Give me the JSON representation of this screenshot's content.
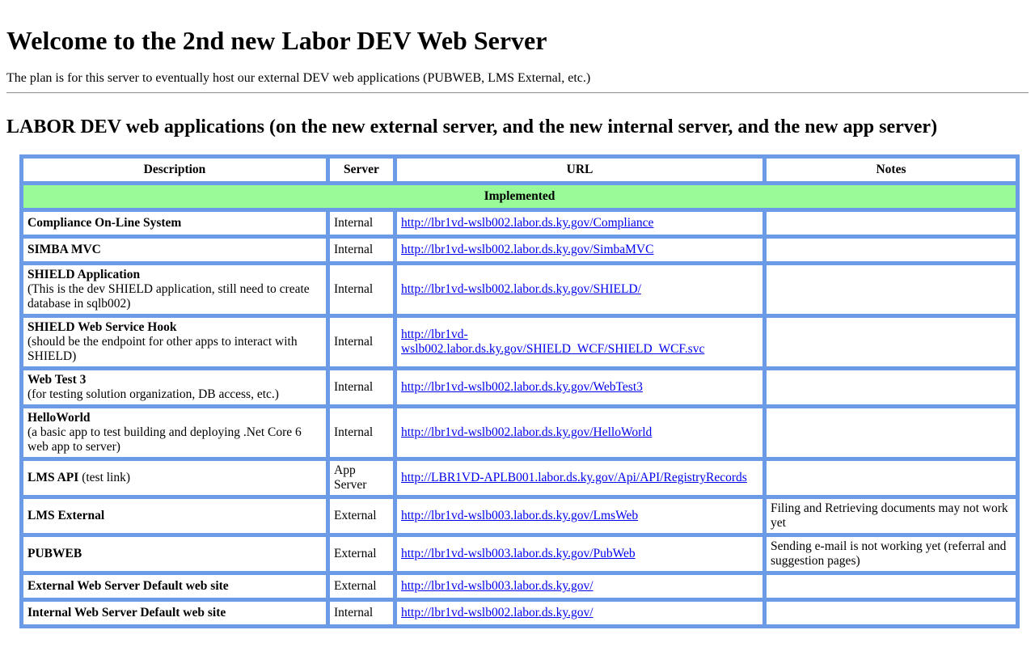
{
  "heading": "Welcome to the 2nd new Labor DEV Web Server",
  "intro": "The plan is for this server to eventually host our external DEV web applications (PUBWEB, LMS External, etc.)",
  "subheading": "LABOR DEV web applications (on the new external server, and the new internal server, and the new app server)",
  "table": {
    "headers": [
      "Description",
      "Server",
      "URL",
      "Notes"
    ],
    "section_label": "Implemented",
    "rows": [
      {
        "name": "Compliance On-Line System",
        "detail": "",
        "server": "Internal",
        "url": "http://lbr1vd-wslb002.labor.ds.ky.gov/Compliance",
        "notes": ""
      },
      {
        "name": "SIMBA MVC",
        "detail": "",
        "server": "Internal",
        "url": "http://lbr1vd-wslb002.labor.ds.ky.gov/SimbaMVC",
        "notes": ""
      },
      {
        "name": "SHIELD Application",
        "detail": "(This is the dev SHIELD application, still need to create database in sqlb002)",
        "server": "Internal",
        "url": "http://lbr1vd-wslb002.labor.ds.ky.gov/SHIELD/",
        "notes": ""
      },
      {
        "name": "SHIELD Web Service Hook",
        "detail": "(should be the endpoint for other apps to interact with SHIELD)",
        "server": "Internal",
        "url": "http://lbr1vd-wslb002.labor.ds.ky.gov/SHIELD_WCF/SHIELD_WCF.svc",
        "notes": ""
      },
      {
        "name": "Web Test 3",
        "detail": "(for testing solution organization, DB access, etc.)",
        "server": "Internal",
        "url": "http://lbr1vd-wslb002.labor.ds.ky.gov/WebTest3",
        "notes": ""
      },
      {
        "name": "HelloWorld",
        "detail": "(a basic app to test building and deploying .Net Core 6 web app to server)",
        "server": "Internal",
        "url": "http://lbr1vd-wslb002.labor.ds.ky.gov/HelloWorld",
        "notes": ""
      },
      {
        "name": "LMS API",
        "detail_inline": "(test link)",
        "server": "App Server",
        "url": "http://LBR1VD-APLB001.labor.ds.ky.gov/Api/API/RegistryRecords",
        "notes": ""
      },
      {
        "name": "LMS External",
        "detail": "",
        "server": "External",
        "url": "http://lbr1vd-wslb003.labor.ds.ky.gov/LmsWeb",
        "notes": "Filing and Retrieving documents may not work yet"
      },
      {
        "name": "PUBWEB",
        "detail": "",
        "server": "External",
        "url": "http://lbr1vd-wslb003.labor.ds.ky.gov/PubWeb",
        "notes": "Sending e-mail is not working yet (referral and suggestion pages)"
      },
      {
        "name": "External Web Server Default web site",
        "detail": "",
        "server": "External",
        "url": "http://lbr1vd-wslb003.labor.ds.ky.gov/",
        "notes": ""
      },
      {
        "name": "Internal Web Server Default web site",
        "detail": "",
        "server": "Internal",
        "url": "http://lbr1vd-wslb002.labor.ds.ky.gov/",
        "notes": ""
      }
    ]
  },
  "colors": {
    "table_border": "#6b9ae6",
    "section_bg": "#98fb98",
    "link": "#0000ee"
  }
}
